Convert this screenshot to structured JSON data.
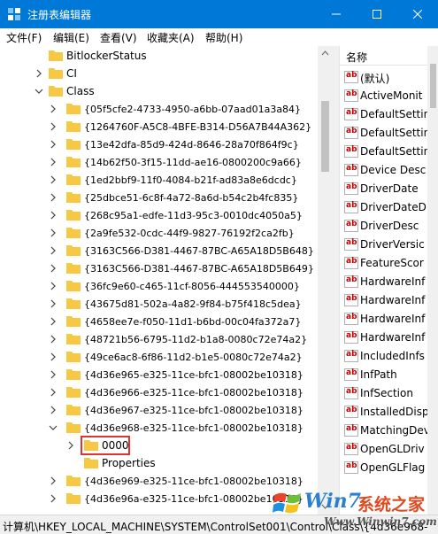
{
  "window": {
    "title": "注册表编辑器",
    "minimize_glyph": "—",
    "colors": {
      "titlebar": "#0078d7",
      "selection_outline": "#e03434",
      "folder": "#f6c844"
    }
  },
  "menu": {
    "items": [
      "文件(F)",
      "编辑(E)",
      "查看(V)",
      "收藏夹(A)",
      "帮助(H)"
    ]
  },
  "tree": {
    "rows": [
      {
        "label": "BitlockerStatus",
        "expander": "none"
      },
      {
        "label": "CI",
        "expander": "collapsed"
      },
      {
        "label": "Class",
        "expander": "expanded"
      },
      {
        "label": "{05f5cfe2-4733-4950-a6bb-07aad01a3a84}",
        "expander": "collapsed"
      },
      {
        "label": "{1264760F-A5C8-4BFE-B314-D56A7B44A362}",
        "expander": "collapsed"
      },
      {
        "label": "{13e42dfa-85d9-424d-8646-28a70f864f9c}",
        "expander": "collapsed"
      },
      {
        "label": "{14b62f50-3f15-11dd-ae16-0800200c9a66}",
        "expander": "collapsed"
      },
      {
        "label": "{1ed2bbf9-11f0-4084-b21f-ad83a8e6dcdc}",
        "expander": "collapsed"
      },
      {
        "label": "{25dbce51-6c8f-4a72-8a6d-b54c2b4fc835}",
        "expander": "collapsed"
      },
      {
        "label": "{268c95a1-edfe-11d3-95c3-0010dc4050a5}",
        "expander": "collapsed"
      },
      {
        "label": "{2a9fe532-0cdc-44f9-9827-76192f2ca2fb}",
        "expander": "collapsed"
      },
      {
        "label": "{3163C566-D381-4467-87BC-A65A18D5B648}",
        "expander": "collapsed"
      },
      {
        "label": "{3163C566-D381-4467-87BC-A65A18D5B649}",
        "expander": "collapsed"
      },
      {
        "label": "{36fc9e60-c465-11cf-8056-444553540000}",
        "expander": "collapsed"
      },
      {
        "label": "{43675d81-502a-4a82-9f84-b75f418c5dea}",
        "expander": "collapsed"
      },
      {
        "label": "{4658ee7e-f050-11d1-b6bd-00c04fa372a7}",
        "expander": "collapsed"
      },
      {
        "label": "{48721b56-6795-11d2-b1a8-0080c72e74a2}",
        "expander": "collapsed"
      },
      {
        "label": "{49ce6ac8-6f86-11d2-b1e5-0080c72e74a2}",
        "expander": "collapsed"
      },
      {
        "label": "{4d36e965-e325-11ce-bfc1-08002be10318}",
        "expander": "collapsed"
      },
      {
        "label": "{4d36e966-e325-11ce-bfc1-08002be10318}",
        "expander": "collapsed"
      },
      {
        "label": "{4d36e967-e325-11ce-bfc1-08002be10318}",
        "expander": "collapsed"
      },
      {
        "label": "{4d36e968-e325-11ce-bfc1-08002be10318}",
        "expander": "expanded"
      },
      {
        "label": "0000",
        "expander": "collapsed",
        "selected": true
      },
      {
        "label": "Properties",
        "expander": "none"
      },
      {
        "label": "{4d36e969-e325-11ce-bfc1-08002be10318}",
        "expander": "collapsed"
      },
      {
        "label": "{4d36e96a-e325-11ce-bfc1-08002be10318}",
        "expander": "collapsed"
      }
    ]
  },
  "values": {
    "column_header": "名称",
    "rows": [
      {
        "name": "(默认)"
      },
      {
        "name": "ActiveMonit"
      },
      {
        "name": "DefaultSettin"
      },
      {
        "name": "DefaultSettin"
      },
      {
        "name": "DefaultSettin"
      },
      {
        "name": "Device Desc"
      },
      {
        "name": "DriverDate"
      },
      {
        "name": "DriverDateD"
      },
      {
        "name": "DriverDesc"
      },
      {
        "name": "DriverVersic"
      },
      {
        "name": "FeatureScor"
      },
      {
        "name": "HardwareInf"
      },
      {
        "name": "HardwareInf"
      },
      {
        "name": "HardwareInf"
      },
      {
        "name": "HardwareInf"
      },
      {
        "name": "IncludedInfs"
      },
      {
        "name": "InfPath"
      },
      {
        "name": "InfSection"
      },
      {
        "name": "InstalledDisp"
      },
      {
        "name": "MatchingDev"
      },
      {
        "name": "OpenGLDriv"
      },
      {
        "name": "OpenGLFlag"
      }
    ],
    "value_icon_text": "ab"
  },
  "status": {
    "path": "计算机\\HKEY_LOCAL_MACHINE\\SYSTEM\\ControlSet001\\Control\\Class\\{4d36e968-"
  },
  "watermark": {
    "brand_a": "Win7",
    "brand_b": "系统之家",
    "url": "Www.Winwin7.com"
  }
}
